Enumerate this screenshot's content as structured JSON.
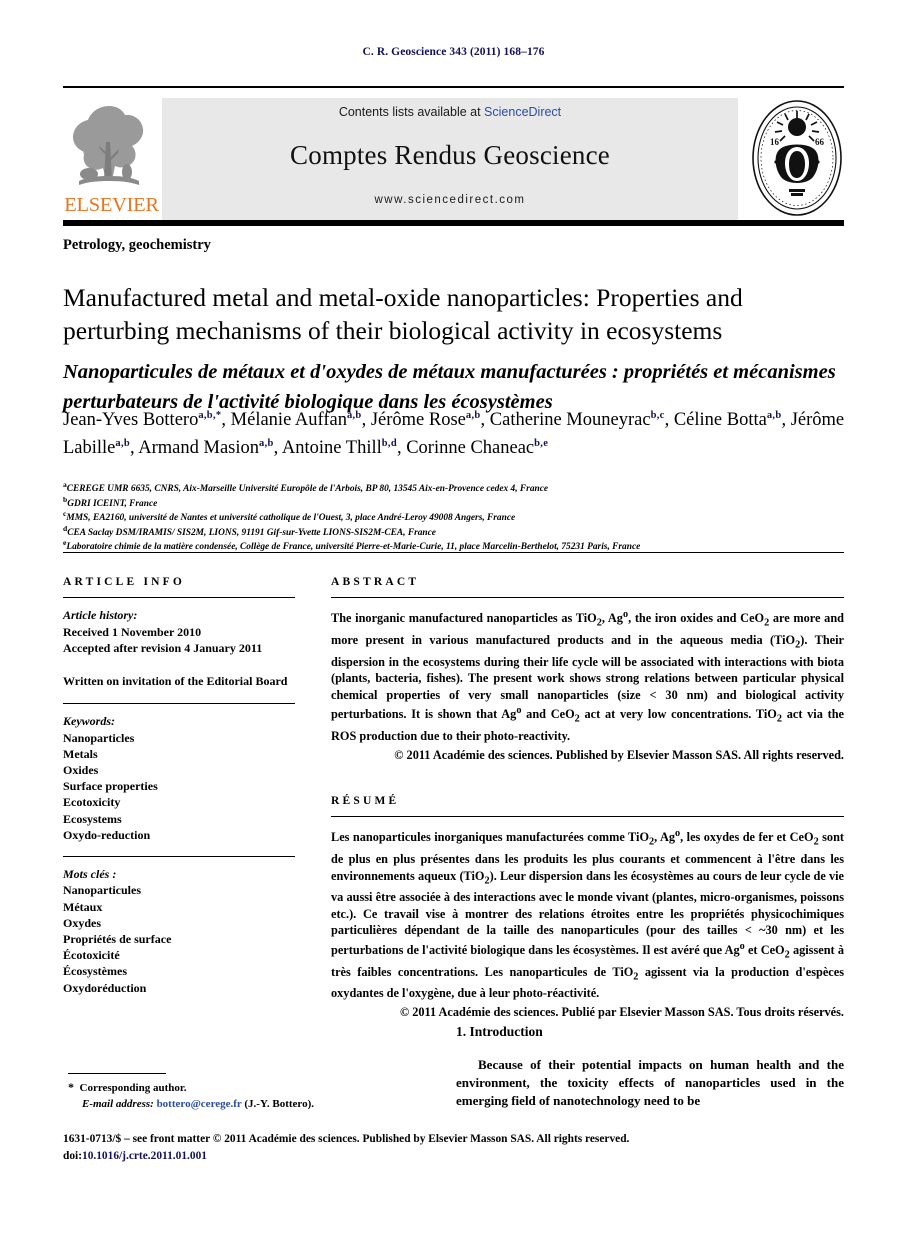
{
  "running_head": "C. R. Geoscience 343 (2011) 168–176",
  "masthead": {
    "contents_prefix": "Contents lists available at ",
    "sciencedirect": "ScienceDirect",
    "journal_title": "Comptes Rendus Geoscience",
    "url": "www.sciencedirect.com",
    "publisher_logo_text": "ELSEVIER",
    "seal_text": "INSTITUT DE FRANCE ACADEMIE DES SCIENCES 1666",
    "band_color": "#e8e8e8",
    "link_color": "#2b4ca6",
    "elsevier_orange": "#e87422"
  },
  "article": {
    "section": "Petrology, geochemistry",
    "title_en": "Manufactured metal and metal-oxide nanoparticles: Properties and perturbing mechanisms of their biological activity in ecosystems",
    "title_fr": "Nanoparticules de métaux et d'oxydes de métaux manufacturées : propriétés et mécanismes perturbateurs de l'activité biologique dans les écosystèmes"
  },
  "authors": [
    {
      "name": "Jean-Yves Bottero",
      "sup": "a,b,*"
    },
    {
      "name": "Mélanie Auffan",
      "sup": "a,b"
    },
    {
      "name": "Jérôme Rose",
      "sup": "a,b"
    },
    {
      "name": "Catherine Mouneyrac",
      "sup": "b,c"
    },
    {
      "name": "Céline Botta",
      "sup": "a,b"
    },
    {
      "name": "Jérôme Labille",
      "sup": "a,b"
    },
    {
      "name": "Armand Masion",
      "sup": "a,b"
    },
    {
      "name": "Antoine Thill",
      "sup": "b,d"
    },
    {
      "name": "Corinne Chaneac",
      "sup": "b,e"
    }
  ],
  "affiliations": [
    {
      "marker": "a",
      "text": "CEREGE UMR 6635, CNRS, Aix-Marseille Université Europôle de l'Arbois, BP 80, 13545 Aix-en-Provence cedex 4, France"
    },
    {
      "marker": "b",
      "text": "GDRI ICEINT, France"
    },
    {
      "marker": "c",
      "text": "MMS, EA2160, université de Nantes et université catholique de l'Ouest, 3, place André-Leroy 49008 Angers, France"
    },
    {
      "marker": "d",
      "text": "CEA Saclay DSM/IRAMIS/ SIS2M, LIONS, 91191 Gif-sur-Yvette LIONS-SIS2M-CEA, France"
    },
    {
      "marker": "e",
      "text": "Laboratoire chimie de la matière condensée, Collège de France, université Pierre-et-Marie-Curie, 11, place Marcelin-Berthelot, 75231 Paris, France"
    }
  ],
  "article_info": {
    "heading": "ARTICLE INFO",
    "history_label": "Article history:",
    "received": "Received 1 November 2010",
    "accepted": "Accepted after revision 4 January 2011",
    "note": "Written on invitation of the Editorial Board",
    "keywords_label": "Keywords:",
    "keywords": [
      "Nanoparticles",
      "Metals",
      "Oxides",
      "Surface properties",
      "Ecotoxicity",
      "Ecosystems",
      "Oxydo-reduction"
    ],
    "motscles_label": "Mots clés :",
    "motscles": [
      "Nanoparticules",
      "Métaux",
      "Oxydes",
      "Propriétés de surface",
      "Écotoxicité",
      "Écosystèmes",
      "Oxydoréduction"
    ]
  },
  "abstract": {
    "heading": "ABSTRACT",
    "body_parts": [
      {
        "t": "The inorganic manufactured nanoparticles as TiO"
      },
      {
        "sub": "2"
      },
      {
        "t": ", Ag"
      },
      {
        "sup": "o"
      },
      {
        "t": ", the iron oxides and CeO"
      },
      {
        "sub": "2"
      },
      {
        "t": " are more and more present in various manufactured products and in the aqueous media (TiO"
      },
      {
        "sub": "2"
      },
      {
        "t": "). Their dispersion in the ecosystems during their life cycle will be associated with interactions with biota (plants, bacteria, fishes). The present work shows strong relations between particular physical chemical properties of very small nanoparticles (size < 30 nm) and biological activity perturbations. It is shown that Ag"
      },
      {
        "sup": "o"
      },
      {
        "t": " and CeO"
      },
      {
        "sub": "2"
      },
      {
        "t": " act at very low concentrations. TiO"
      },
      {
        "sub": "2"
      },
      {
        "t": " act via the ROS production due to their photo-reactivity."
      }
    ],
    "copyright": "© 2011 Académie des sciences. Published by Elsevier Masson SAS. All rights reserved."
  },
  "resume": {
    "heading": "RÉSUMÉ",
    "body_parts": [
      {
        "t": "Les nanoparticules inorganiques manufacturées comme TiO"
      },
      {
        "sub": "2"
      },
      {
        "t": ", Ag"
      },
      {
        "sup": "o"
      },
      {
        "t": ", les oxydes de fer et CeO"
      },
      {
        "sub": "2"
      },
      {
        "t": " sont de plus en plus présentes dans les produits les plus courants et commencent à l'être dans les environnements aqueux (TiO"
      },
      {
        "sub": "2"
      },
      {
        "t": "). Leur dispersion dans les écosystèmes au cours de leur cycle de vie va aussi être associée à des interactions avec le monde vivant (plantes, micro-organismes, poissons etc.). Ce travail vise à montrer des relations étroites entre les propriétés physicochimiques particulières dépendant de la taille des nanoparticules (pour des tailles < ~30 nm) et les perturbations de l'activité biologique dans les écosystèmes. Il est avéré que Ag"
      },
      {
        "sup": "o"
      },
      {
        "t": " et CeO"
      },
      {
        "sub": "2"
      },
      {
        "t": " agissent à très faibles concentrations. Les nanoparticules de TiO"
      },
      {
        "sub": "2"
      },
      {
        "t": " agissent via la production d'espèces oxydantes de l'oxygène, due à leur photo-réactivité."
      }
    ],
    "copyright": "© 2011 Académie des sciences. Publié par Elsevier Masson SAS. Tous droits réservés."
  },
  "introduction": {
    "heading": "1. Introduction",
    "paragraph": "Because of their potential impacts on human health and the environment, the toxicity effects of nanoparticles used in the emerging field of nanotechnology need to be"
  },
  "footnote": {
    "star": "*",
    "corresponding": "Corresponding author.",
    "email_label": "E-mail address:",
    "email": "bottero@cerege.fr",
    "email_owner": "(J.-Y. Bottero)."
  },
  "footer": {
    "issn_line": "1631-0713/$ – see front matter © 2011 Académie des sciences. Published by Elsevier Masson SAS. All rights reserved.",
    "doi_label": "doi:",
    "doi": "10.1016/j.crte.2011.01.001"
  }
}
